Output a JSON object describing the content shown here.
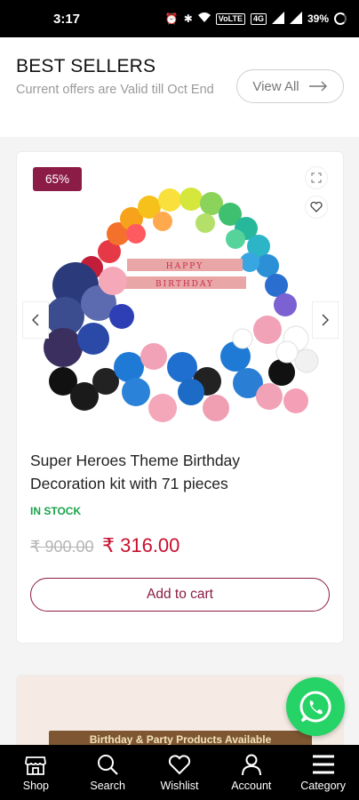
{
  "status_bar": {
    "time": "3:17",
    "network_label_1": "VoLTE",
    "network_label_2": "4G",
    "battery": "39%"
  },
  "section": {
    "title": "BEST SELLERS",
    "subtitle": "Current offers are Valid till Oct End",
    "view_all_label": "View All"
  },
  "product": {
    "discount_badge": "65%",
    "name": "Super Heroes Theme Birthday Decoration kit with 71 pieces",
    "stock_status": "IN STOCK",
    "old_price": "₹ 900.00",
    "new_price": "₹ 316.00",
    "add_to_cart_label": "Add to cart",
    "image_banner_text": "HAPPY BIRTHDAY",
    "icons": [
      "expand-icon",
      "heart-icon",
      "chevron-left-icon",
      "chevron-right-icon"
    ]
  },
  "next_card": {
    "banner_text": "Birthday & Party Products Available"
  },
  "bottom_nav": [
    {
      "label": "Shop",
      "icon": "shop-icon"
    },
    {
      "label": "Search",
      "icon": "search-icon"
    },
    {
      "label": "Wishlist",
      "icon": "heart-icon"
    },
    {
      "label": "Account",
      "icon": "user-icon"
    },
    {
      "label": "Category",
      "icon": "menu-icon"
    }
  ],
  "colors": {
    "accent": "#8a1c45",
    "price": "#c8102e",
    "in_stock": "#1aa34a",
    "whatsapp": "#25d366"
  }
}
